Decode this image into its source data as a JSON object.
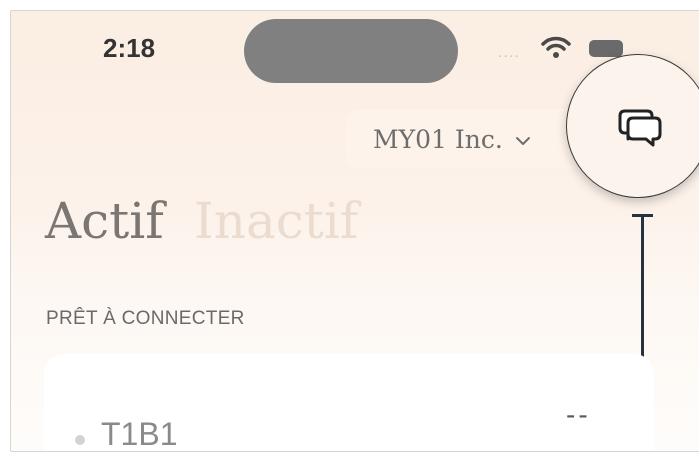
{
  "status_bar": {
    "time": "2:18",
    "signal": "....",
    "wifi_icon": "wifi-icon",
    "battery_icon": "battery-icon"
  },
  "header": {
    "organization": "MY01 Inc.",
    "chevron_icon": "chevron-down-icon",
    "chat_icon": "chat-bubbles-icon"
  },
  "tabs": [
    {
      "label": "Actif",
      "active": true
    },
    {
      "label": "Inactif",
      "active": false
    }
  ],
  "section": {
    "title": "PRÊT À CONNECTER"
  },
  "devices": [
    {
      "name": "T1B1",
      "value": "--",
      "status_color": "#d2d2d2"
    }
  ],
  "colors": {
    "accent": "#26323e",
    "background_top": "#fbeee3",
    "tab_inactive": "#ecdcd0"
  }
}
